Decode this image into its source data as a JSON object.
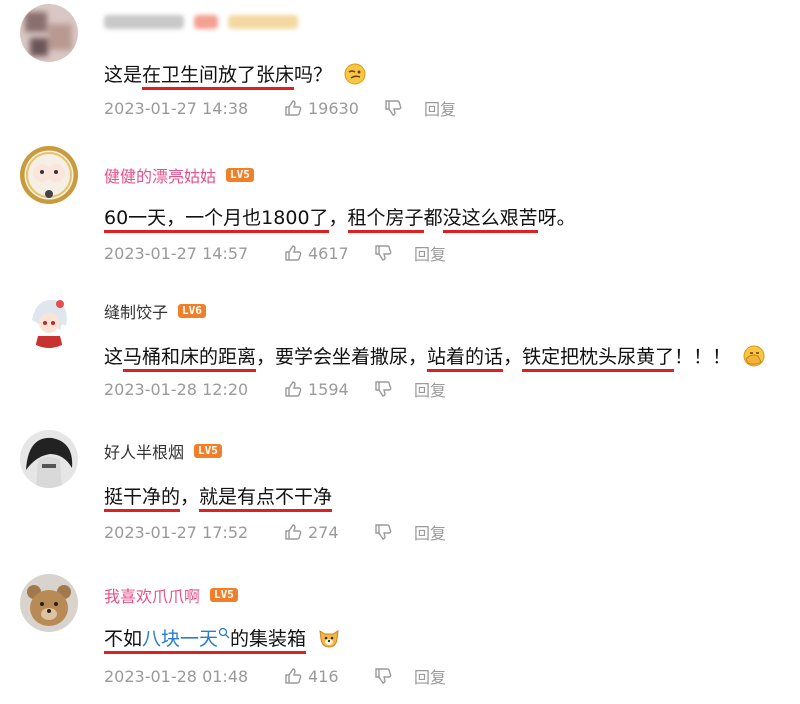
{
  "comments": [
    {
      "username": "",
      "level": "",
      "text_parts": [
        {
          "t": "这是",
          "u": false
        },
        {
          "t": "在卫生间放了张床",
          "u": true
        },
        {
          "t": "吗？",
          "u": false
        }
      ],
      "emoji": "thinking-face-icon",
      "time": "2023-01-27 14:38",
      "likes": "19630",
      "reply": "回复"
    },
    {
      "username": "健健的漂亮姑姑",
      "level": "LV5",
      "name_color": "#e8508a",
      "text_parts": [
        {
          "t": "60一天，一个月也1800了",
          "u": true
        },
        {
          "t": "，",
          "u": false
        },
        {
          "t": "租个房子",
          "u": true
        },
        {
          "t": "都",
          "u": false
        },
        {
          "t": "没这么艰苦",
          "u": true
        },
        {
          "t": "呀。",
          "u": false
        }
      ],
      "time": "2023-01-27 14:57",
      "likes": "4617",
      "reply": "回复"
    },
    {
      "username": "缝制饺子",
      "level": "LV6",
      "name_color": "#333333",
      "text_parts": [
        {
          "t": "这",
          "u": false
        },
        {
          "t": "马桶和床的距离",
          "u": true
        },
        {
          "t": "，要学会坐着撒尿，",
          "u": false
        },
        {
          "t": "站着的话",
          "u": true
        },
        {
          "t": "，",
          "u": false
        },
        {
          "t": "铁定把枕头尿黄了",
          "u": true
        },
        {
          "t": "！！！",
          "u": false
        }
      ],
      "emoji": "facepalm-icon",
      "time": "2023-01-28 12:20",
      "likes": "1594",
      "reply": "回复"
    },
    {
      "username": "好人半根烟",
      "level": "LV5",
      "name_color": "#333333",
      "text_parts": [
        {
          "t": "挺干净的",
          "u": true
        },
        {
          "t": "，",
          "u": false
        },
        {
          "t": "就是有点不干净",
          "u": true
        }
      ],
      "time": "2023-01-27 17:52",
      "likes": "274",
      "reply": "回复"
    },
    {
      "username": "我喜欢爪爪啊",
      "level": "LV5",
      "name_color": "#e8508a",
      "text_parts": [
        {
          "t": "不如",
          "u": true
        },
        {
          "t": "八块一天",
          "u": true,
          "link": true
        },
        {
          "t": "的集装箱",
          "u": true
        }
      ],
      "emoji": "dog-face-icon",
      "time": "2023-01-28 01:48",
      "likes": "416",
      "reply": "回复"
    }
  ],
  "colors": {
    "underline": "#e02020",
    "link": "#2a7ec9",
    "level_badge": "#f07f2a",
    "meta": "#9a9a9a"
  }
}
